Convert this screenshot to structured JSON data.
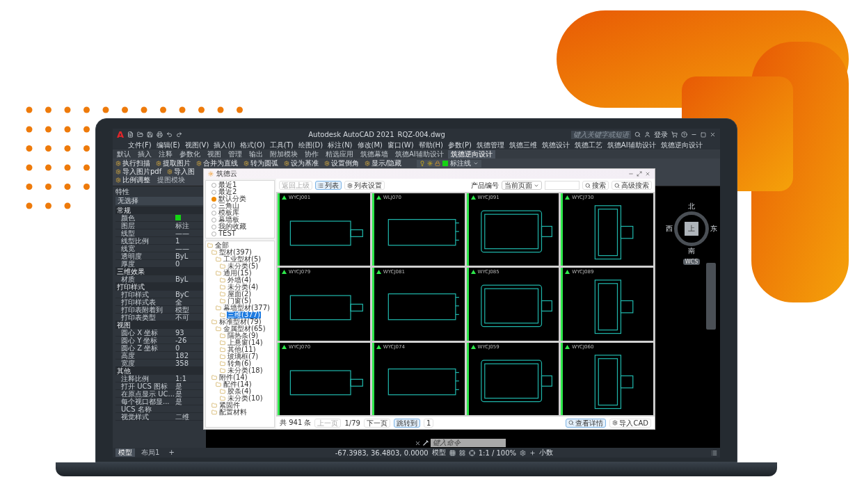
{
  "titlebar": {
    "logo": "A",
    "app_title": "Autodesk AutoCAD 2021",
    "file_name": "RQZ-004.dwg",
    "search": {
      "placeholder": "键入关键字或短语"
    },
    "login": "登录"
  },
  "menu": [
    "文件(F)",
    "编辑(E)",
    "视图(V)",
    "插入(I)",
    "格式(O)",
    "工具(T)",
    "绘图(D)",
    "标注(N)",
    "修改(M)",
    "窗口(W)",
    "帮助(H)",
    "参数(P)",
    "筑德管理",
    "筑德三维",
    "筑德设计",
    "筑德工艺",
    "筑德AI辅助设计",
    "筑德逆向设计"
  ],
  "ribbon_tabs": [
    {
      "label": "默认",
      "selected": false
    },
    {
      "label": "插入",
      "selected": false
    },
    {
      "label": "注释",
      "selected": false
    },
    {
      "label": "参数化",
      "selected": false
    },
    {
      "label": "视图",
      "selected": false
    },
    {
      "label": "管理",
      "selected": false
    },
    {
      "label": "输出",
      "selected": false
    },
    {
      "label": "附加模块",
      "selected": false
    },
    {
      "label": "协作",
      "selected": false
    },
    {
      "label": "精选应用",
      "selected": false
    },
    {
      "label": "筑德幕墙",
      "selected": false
    },
    {
      "label": "筑德AI辅助设计",
      "selected": false
    },
    {
      "label": "筑德逆向设计",
      "selected": true
    }
  ],
  "ribbon": {
    "rows": [
      [
        "执行扫描",
        "提取图片",
        "合并为直线",
        "转为圆弧",
        "设为基准",
        "设置倒角",
        "显示/隐藏"
      ],
      [
        "导入图片pdf",
        "导入图"
      ],
      [
        "比例调整"
      ]
    ],
    "panel_label": "提图模块",
    "layer": "标注线"
  },
  "properties": {
    "title": "特性",
    "selection": "无选择",
    "sections": [
      {
        "title": "常规",
        "rows": [
          {
            "label": "颜色",
            "kind": "swatch"
          },
          {
            "label": "图层",
            "value": "标注",
            "kind": "text"
          },
          {
            "label": "线型",
            "value": "——",
            "kind": "text"
          },
          {
            "label": "线型比例",
            "value": "1",
            "kind": "text"
          },
          {
            "label": "线宽",
            "value": "——",
            "kind": "text"
          },
          {
            "label": "透明度",
            "value": "ByL",
            "kind": "text"
          },
          {
            "label": "厚度",
            "value": "0",
            "kind": "text"
          }
        ]
      },
      {
        "title": "三维效果",
        "rows": [
          {
            "label": "材质",
            "value": "ByL",
            "kind": "text"
          }
        ]
      },
      {
        "title": "打印样式",
        "rows": [
          {
            "label": "打印样式",
            "value": "ByC",
            "kind": "text"
          },
          {
            "label": "打印样式表",
            "value": "全",
            "kind": "text"
          },
          {
            "label": "打印表附着到",
            "value": "模型",
            "kind": "text"
          },
          {
            "label": "打印表类型",
            "value": "不可",
            "kind": "text"
          }
        ]
      },
      {
        "title": "视图",
        "rows": [
          {
            "label": "圆心 X 坐标",
            "value": "93",
            "kind": "text"
          },
          {
            "label": "圆心 Y 坐标",
            "value": "-26",
            "kind": "text"
          },
          {
            "label": "圆心 Z 坐标",
            "value": "0",
            "kind": "text"
          },
          {
            "label": "高度",
            "value": "182",
            "kind": "text"
          },
          {
            "label": "宽度",
            "value": "358",
            "kind": "text"
          }
        ]
      },
      {
        "title": "其他",
        "rows": [
          {
            "label": "注释比例",
            "value": "1:1",
            "kind": "text"
          },
          {
            "label": "打开 UCS 图标",
            "value": "是",
            "kind": "text"
          },
          {
            "label": "在原点显示 UC...",
            "value": "是",
            "kind": "text"
          },
          {
            "label": "每个视口都显...",
            "value": "是",
            "kind": "text"
          },
          {
            "label": "UCS 名称",
            "kind": "text"
          },
          {
            "label": "视觉样式",
            "value": "二维",
            "kind": "text"
          }
        ]
      }
    ]
  },
  "dialog": {
    "title": "筑德云",
    "toolbar": [
      {
        "label": "返回上级",
        "disabled": true,
        "selected": false
      },
      {
        "label": "列表",
        "disabled": false,
        "selected": true
      },
      {
        "label": "列表设置",
        "disabled": false,
        "selected": false
      }
    ],
    "product_code_label": "产品编号",
    "scope_select": "当前页面",
    "search_button": "搜索",
    "advanced_search_button": "高级搜索",
    "library": [
      {
        "label": "最近1",
        "selected": false
      },
      {
        "label": "最近2",
        "selected": false
      },
      {
        "label": "默认分类",
        "selected": true
      },
      {
        "label": "三角山",
        "selected": false
      },
      {
        "label": "模板库",
        "selected": false
      },
      {
        "label": "幕墙板",
        "selected": false
      },
      {
        "label": "我的收藏",
        "selected": false
      },
      {
        "label": "TEST",
        "selected": false
      }
    ],
    "tree": [
      {
        "label": "全部",
        "selected": false,
        "children": [
          {
            "label": "型材(397)",
            "selected": false,
            "children": [
              {
                "label": "工业型材(5)",
                "selected": false,
                "children": [
                  {
                    "label": "未分类(5)",
                    "selected": false
                  }
                ]
              },
              {
                "label": "通用(15)",
                "selected": false,
                "children": [
                  {
                    "label": "外墙(4)",
                    "selected": false
                  },
                  {
                    "label": "未分类(4)",
                    "selected": false
                  },
                  {
                    "label": "屋面(2)",
                    "selected": false
                  },
                  {
                    "label": "门窗(5)",
                    "selected": false
                  }
                ]
              },
              {
                "label": "幕墙型材(377)",
                "selected": false,
                "children": [
                  {
                    "label": "三维(377)",
                    "selected": true
                  }
                ]
              }
            ]
          },
          {
            "label": "标准型材(79)",
            "selected": false,
            "children": [
              {
                "label": "金属型材(65)",
                "selected": false,
                "children": [
                  {
                    "label": "隔热条(9)",
                    "selected": false
                  },
                  {
                    "label": "上悬窗(14)",
                    "selected": false
                  },
                  {
                    "label": "其他(11)",
                    "selected": false
                  },
                  {
                    "label": "玻璃框(7)",
                    "selected": false
                  },
                  {
                    "label": "转角(6)",
                    "selected": false
                  },
                  {
                    "label": "未分类(18)",
                    "selected": false
                  }
                ]
              }
            ]
          },
          {
            "label": "附件(14)",
            "selected": false,
            "children": [
              {
                "label": "配件(14)",
                "selected": false,
                "children": [
                  {
                    "label": "胶条(4)",
                    "selected": false
                  },
                  {
                    "label": "未分类(10)",
                    "selected": false
                  }
                ]
              }
            ]
          },
          {
            "label": "紧固件",
            "selected": false
          },
          {
            "label": "配置材料",
            "selected": false
          }
        ]
      }
    ],
    "profiles": [
      {
        "code": "WYCJ001"
      },
      {
        "code": "WLJ070"
      },
      {
        "code": "WYCJ091"
      },
      {
        "code": "WYCJ730"
      },
      {
        "code": "WYCJ079"
      },
      {
        "code": "WYCJ081"
      },
      {
        "code": "WYCJ085"
      },
      {
        "code": "WYCJ089"
      },
      {
        "code": "WYCJ070"
      },
      {
        "code": "WYCJ074"
      },
      {
        "code": "WYCJ059"
      },
      {
        "code": "WYCJ060"
      }
    ],
    "footer": {
      "total": "共 941 条",
      "prev": "上一页",
      "page": "1/79",
      "next": "下一页",
      "jump": "跳转到",
      "page_input": "1",
      "details": "查看详情",
      "import": "导入CAD"
    }
  },
  "viewcube": {
    "north": "北",
    "south": "南",
    "east": "东",
    "west": "西",
    "top": "上",
    "wcs": "WCS"
  },
  "command_line": {
    "placeholder": "键入命令"
  },
  "layout_tabs": [
    {
      "label": "模型",
      "selected": true
    },
    {
      "label": "布局1",
      "selected": false
    }
  ],
  "add_tab": "+",
  "status_bar": {
    "coordinates": "-67.3983, 36.4803, 0.0000",
    "model": "模型",
    "scale": "1:1 / 100%",
    "units": "小数"
  }
}
